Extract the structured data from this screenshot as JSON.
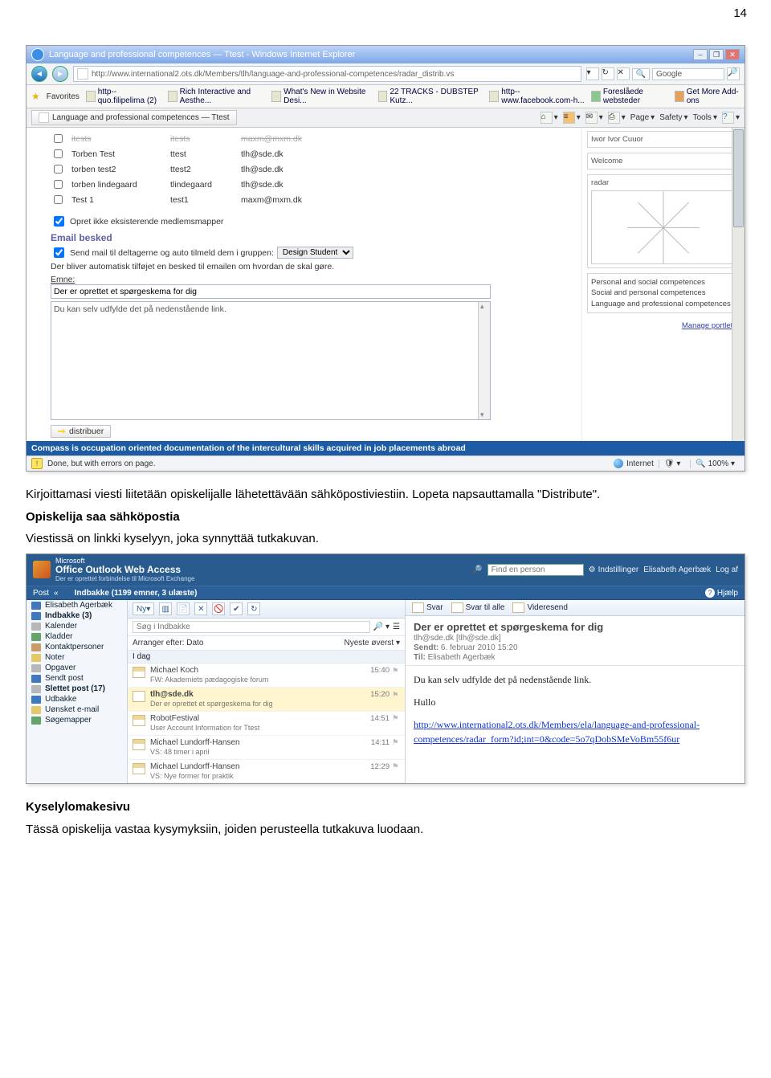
{
  "page_number": "14",
  "text": {
    "para1": "Kirjoittamasi viesti liitetään opiskelijalle lähetettävään sähköpostiviestiin. Lopeta napsauttamalla \"Distribute\".",
    "heading2": "Opiskelija saa sähköpostia",
    "para2": "Viestissä on linkki kyselyyn, joka synnyttää tutkakuvan.",
    "heading3": "Kyselylomakesivu",
    "para3": "Tässä opiskelija vastaa kysymyksiin, joiden perusteella tutkakuva luodaan."
  },
  "ie": {
    "title": "Language and professional competences — Ttest - Windows Internet Explorer",
    "address": "http://www.international2.ots.dk/Members/tlh/language-and-professional-competences/radar_distrib.vs",
    "search_placeholder": "Google",
    "favorites_label": "Favorites",
    "fav_links": [
      "http--quo.filipelima (2)",
      "Rich Interactive and Aesthe...",
      "What's New in Website Desi...",
      "22 TRACKS - DUBSTEP Kutz...",
      "http--www.facebook.com-h...",
      "Foreslåede websteder",
      "Get More Add-ons"
    ],
    "tab_label": "Language and professional competences — Ttest",
    "toolbar": {
      "page": "Page",
      "safety": "Safety",
      "tools": "Tools"
    },
    "users_header": [
      "itests",
      "itests",
      "maxm@mxm.dk"
    ],
    "users": [
      {
        "name": "Torben Test",
        "login": "ttest",
        "email": "tlh@sde.dk"
      },
      {
        "name": "torben test2",
        "login": "ttest2",
        "email": "tlh@sde.dk"
      },
      {
        "name": "torben lindegaard",
        "login": "tlindegaard",
        "email": "tlh@sde.dk"
      },
      {
        "name": "Test 1",
        "login": "test1",
        "email": "maxm@mxm.dk"
      }
    ],
    "opret_row": "Opret ikke eksisterende medlemsmapper",
    "email_section": "Email besked",
    "send_mail_label": "Send mail til deltagerne og auto tilmeld dem i gruppen:",
    "group_option": "Design Student",
    "auto_note": "Der bliver automatisk tilføjet en besked til emailen om hvordan de skal gøre.",
    "emne_label": "Emne:",
    "emne_value": "Der er oprettet et spørgeskema for dig",
    "body_value": "Du kan selv udfylde det på nedenstående link.",
    "distribute_label": "distribuer",
    "compass_footer": "Compass is occupation oriented documentation of the intercultural skills acquired in job placements abroad",
    "right_col": {
      "iwor": "Iwor Ivor Cuuor",
      "welcome": "Welcome",
      "radar": "radar",
      "caps": [
        "Personal and social competences",
        "Social and personal competences",
        "Language and professional competences"
      ],
      "manage": "Manage portlets"
    },
    "status_left": "Done, but with errors on page.",
    "status_zone": "Internet",
    "status_zoom": "100%"
  },
  "owa": {
    "brand_small": "Microsoft",
    "brand": "Office Outlook Web Access",
    "sub": "Der er oprettet forbindelse til Microsoft Exchange",
    "find_placeholder": "Find en person",
    "settings": "Indstillinger",
    "user": "Elisabeth Agerbæk",
    "logout": "Log af",
    "post_label": "Post",
    "help_label": "Hjælp",
    "inbox_header": "Indbakke (1199 emner, 3 ulæste)",
    "folders": [
      {
        "label": "Elisabeth Agerbæk",
        "icon": "blue",
        "bold": false
      },
      {
        "label": "Indbakke (3)",
        "icon": "blue",
        "bold": true
      },
      {
        "label": "Kalender",
        "icon": "gray",
        "bold": false
      },
      {
        "label": "Kladder",
        "icon": "green",
        "bold": false
      },
      {
        "label": "Kontaktpersoner",
        "icon": "red",
        "bold": false
      },
      {
        "label": "Noter",
        "icon": "yellow",
        "bold": false
      },
      {
        "label": "Opgaver",
        "icon": "gray",
        "bold": false
      },
      {
        "label": "Sendt post",
        "icon": "blue",
        "bold": false
      },
      {
        "label": "Slettet post (17)",
        "icon": "gray",
        "bold": true
      },
      {
        "label": "Udbakke",
        "icon": "blue",
        "bold": false
      },
      {
        "label": "Uønsket e-mail",
        "icon": "yellow",
        "bold": false
      },
      {
        "label": "Søgemapper",
        "icon": "green",
        "bold": false
      }
    ],
    "new_label": "Ny",
    "search_inbox": "Søg i Indbakke",
    "arrange": "Arranger efter: Dato",
    "newest": "Nyeste øverst",
    "today_label": "I dag",
    "messages": [
      {
        "from": "Michael Koch",
        "subj": "FW: Akademiets pædagogiske forum",
        "time": "15:40",
        "bold": false,
        "sel": false
      },
      {
        "from": "tlh@sde.dk",
        "subj": "Der er oprettet et spørgeskema for dig",
        "time": "15:20",
        "bold": true,
        "sel": true
      },
      {
        "from": "RobotFestival",
        "subj": "User Account Information for Ttest",
        "time": "14:51",
        "bold": false,
        "sel": false
      },
      {
        "from": "Michael Lundorff-Hansen",
        "subj": "VS: 48 timer i april",
        "time": "14:11",
        "bold": false,
        "sel": false
      },
      {
        "from": "Michael Lundorff-Hansen",
        "subj": "VS: Nye former for praktik",
        "time": "12:29",
        "bold": false,
        "sel": false
      }
    ],
    "actions": {
      "reply": "Svar",
      "replyall": "Svar til alle",
      "forward": "Videresend"
    },
    "mail": {
      "subject": "Der er oprettet et spørgeskema for dig",
      "from_line": "tlh@sde.dk [tlh@sde.dk]",
      "sent_label": "Sendt:",
      "sent_value": "6. februar 2010 15:20",
      "to_label": "Til:",
      "to_value": "Elisabeth Agerbæk",
      "body_line1": "Du kan selv udfylde det på nedenstående link.",
      "body_line2": "Hullo",
      "link": "http://www.international2.ots.dk/Members/ela/language-and-professional-competences/radar_form?id;int=0&code=5o7qDobSMeVoBm55f6ur"
    }
  }
}
